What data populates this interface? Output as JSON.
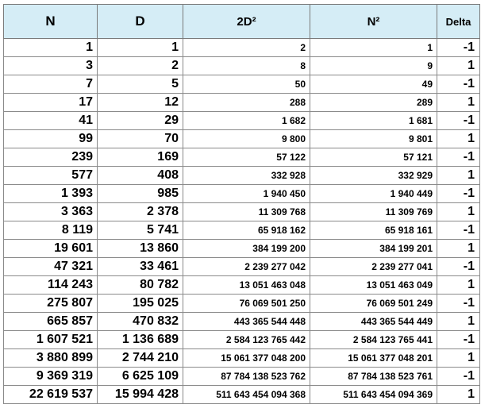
{
  "table": {
    "headers": [
      "N",
      "D",
      "2D²",
      "N²",
      "Delta"
    ],
    "rows": [
      [
        "1",
        "1",
        "2",
        "1",
        "-1"
      ],
      [
        "3",
        "2",
        "8",
        "9",
        "1"
      ],
      [
        "7",
        "5",
        "50",
        "49",
        "-1"
      ],
      [
        "17",
        "12",
        "288",
        "289",
        "1"
      ],
      [
        "41",
        "29",
        "1 682",
        "1 681",
        "-1"
      ],
      [
        "99",
        "70",
        "9 800",
        "9 801",
        "1"
      ],
      [
        "239",
        "169",
        "57 122",
        "57 121",
        "-1"
      ],
      [
        "577",
        "408",
        "332 928",
        "332 929",
        "1"
      ],
      [
        "1 393",
        "985",
        "1 940 450",
        "1 940 449",
        "-1"
      ],
      [
        "3 363",
        "2 378",
        "11 309 768",
        "11 309 769",
        "1"
      ],
      [
        "8 119",
        "5 741",
        "65 918 162",
        "65 918 161",
        "-1"
      ],
      [
        "19 601",
        "13 860",
        "384 199 200",
        "384 199 201",
        "1"
      ],
      [
        "47 321",
        "33 461",
        "2 239 277 042",
        "2 239 277 041",
        "-1"
      ],
      [
        "114 243",
        "80 782",
        "13 051 463 048",
        "13 051 463 049",
        "1"
      ],
      [
        "275 807",
        "195 025",
        "76 069 501 250",
        "76 069 501 249",
        "-1"
      ],
      [
        "665 857",
        "470 832",
        "443 365 544 448",
        "443 365 544 449",
        "1"
      ],
      [
        "1 607 521",
        "1 136 689",
        "2 584 123 765 442",
        "2 584 123 765 441",
        "-1"
      ],
      [
        "3 880 899",
        "2 744 210",
        "15 061 377 048 200",
        "15 061 377 048 201",
        "1"
      ],
      [
        "9 369 319",
        "6 625 109",
        "87 784 138 523 762",
        "87 784 138 523 761",
        "-1"
      ],
      [
        "22 619 537",
        "15 994 428",
        "511 643 454 094 368",
        "511 643 454 094 369",
        "1"
      ]
    ]
  }
}
